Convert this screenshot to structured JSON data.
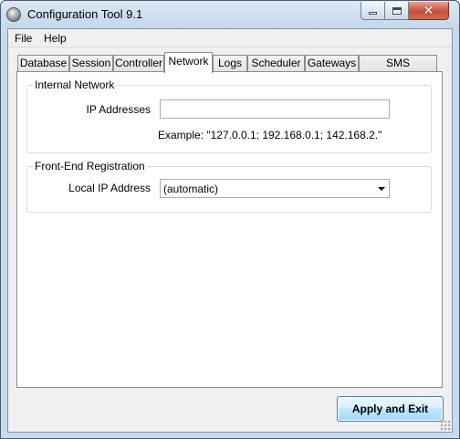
{
  "window": {
    "title": "Configuration Tool 9.1",
    "close_glyph": "✕"
  },
  "menu": {
    "items": [
      {
        "label": "File"
      },
      {
        "label": "Help"
      }
    ]
  },
  "tabs": [
    {
      "label": "Database"
    },
    {
      "label": "Session"
    },
    {
      "label": "Controller"
    },
    {
      "label": "Network",
      "active": true
    },
    {
      "label": "Logs"
    },
    {
      "label": "Scheduler"
    },
    {
      "label": "Gateways"
    },
    {
      "label": "SMS Connector"
    }
  ],
  "internal_network": {
    "caption": "Internal Network",
    "ip_label": "IP Addresses",
    "ip_value": "",
    "example": "Example: \"127.0.0.1; 192.168.0.1; 142.168.2.\""
  },
  "front_end": {
    "caption": "Front-End Registration",
    "local_ip_label": "Local IP Address",
    "local_ip_value": "(automatic)"
  },
  "buttons": {
    "apply_exit": "Apply and Exit"
  },
  "icons": {
    "app": "app-globe-icon",
    "minimize": "minimize-icon",
    "maximize": "maximize-icon",
    "close": "close-icon",
    "dropdown": "chevron-down-icon",
    "resize": "resize-grip-icon"
  }
}
